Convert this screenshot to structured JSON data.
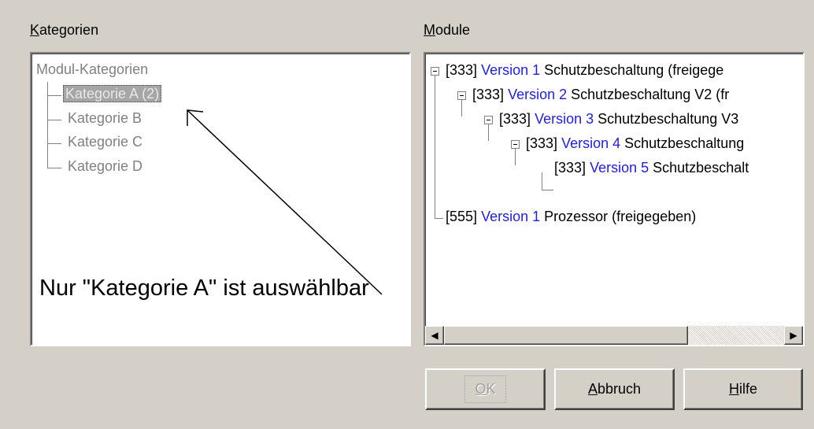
{
  "kategorien": {
    "label_hotkey": "K",
    "label_rest": "ategorien",
    "root": "Modul-Kategorien",
    "items": [
      "Kategorie A (2)",
      "Kategorie B",
      "Kategorie C",
      "Kategorie D"
    ],
    "selected_index": 0,
    "annotation": "Nur \"Kategorie A\" ist auswählbar"
  },
  "module": {
    "label_hotkey": "M",
    "label_rest": "odule",
    "rows": [
      {
        "id": "[333]",
        "version": "Version 1",
        "text": "Schutzbeschaltung (freigege"
      },
      {
        "id": "[333]",
        "version": "Version 2",
        "text": "Schutzbeschaltung V2 (fr"
      },
      {
        "id": "[333]",
        "version": "Version 3",
        "text": "Schutzbeschaltung V3"
      },
      {
        "id": "[333]",
        "version": "Version 4",
        "text": "Schutzbeschaltung"
      },
      {
        "id": "[333]",
        "version": "Version 5",
        "text": "Schutzbeschalt"
      },
      {
        "id": "[555]",
        "version": "Version 1",
        "text": "Prozessor (freigegeben)"
      }
    ],
    "scroll_left_glyph": "◀",
    "scroll_right_glyph": "▶"
  },
  "buttons": {
    "ok_hotkey": "O",
    "ok_rest": "K",
    "abbruch_hotkey": "A",
    "abbruch_rest": "bbruch",
    "hilfe_hotkey": "H",
    "hilfe_rest": "ilfe"
  },
  "colors": {
    "dialog_bg": "#d4d0c8",
    "version_link": "#1e1ee8",
    "inactive_text": "#808080"
  }
}
